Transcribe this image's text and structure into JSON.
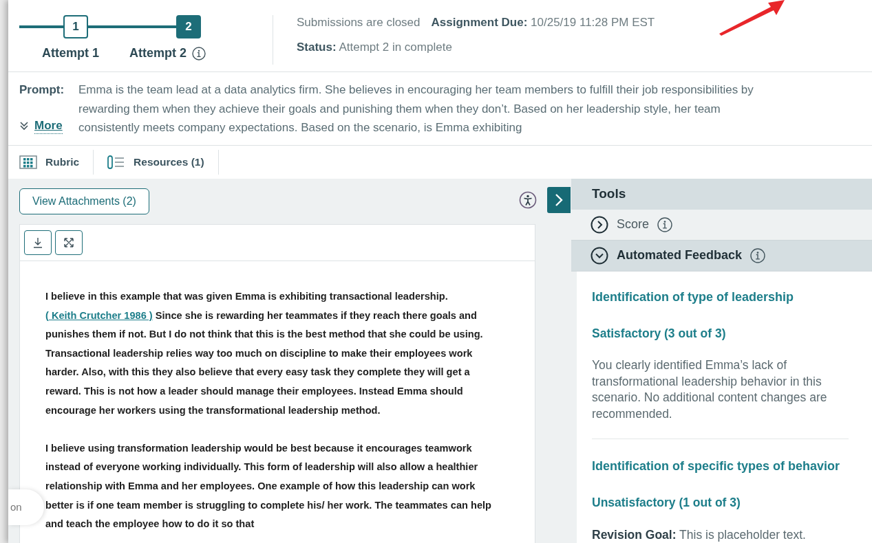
{
  "attempts": [
    {
      "number": "1",
      "label": "Attempt 1",
      "selected": false,
      "info_icon": false
    },
    {
      "number": "2",
      "label": "Attempt 2",
      "selected": true,
      "info_icon": true
    }
  ],
  "submission_note": "Submissions are closed",
  "due": {
    "label": "Assignment Due:",
    "value": "10/25/19 11:28 PM EST"
  },
  "status": {
    "label": "Status:",
    "value": "Attempt 2 in complete"
  },
  "prompt": {
    "label": "Prompt:",
    "more": "More",
    "text": "Emma is the team lead at a data analytics firm. She believes in encouraging her team members to fulfill their job responsibilities by rewarding them when they achieve their goals and punishing them when they don’t. Based on her leadership style, her team consistently meets company expectations. Based on the scenario, is Emma exhibiting"
  },
  "tabs": [
    {
      "kind": "rubric",
      "label": "Rubric"
    },
    {
      "kind": "resources",
      "label": "Resources (1)"
    }
  ],
  "attachments_button": "View Attachments (2)",
  "essay": [
    [
      {
        "kind": "text",
        "text": "I believe in this example that was given Emma is exhibiting transactional leadership."
      },
      {
        "kind": "citation",
        "text": "( Keith Crutcher 1986 )"
      },
      {
        "kind": "text",
        "text": "Since she is rewarding her teammates if they reach there goals and punishes them if not. But I do not think that this is the best method that she could be using. Transactional leadership relies way too much on discipline to make their employees work harder. Also, with this they also believe that every easy task they complete they will get a reward. This is not how a leader should manage their employees. Instead Emma should encourage her workers using the transformational leadership method."
      }
    ],
    [
      {
        "kind": "text",
        "text": "I believe using transformation leadership would be best because it encourages teamwork instead of everyone working individually. This form of leadership will also allow a healthier relationship with Emma and her employees. One example of how this leadership can work better is if one team member is struggling to complete his/ her work. The teammates can help and teach the employee how to do it so that"
      }
    ]
  ],
  "floating_tab": "on",
  "tools": {
    "title": "Tools",
    "sections": [
      {
        "title": "Score",
        "expanded": false
      },
      {
        "title": "Automated Feedback",
        "expanded": true
      }
    ]
  },
  "feedback": [
    {
      "kind": "comment",
      "criterion": "Identification of type of leadership",
      "rating": "Satisfactory (3 out of 3)",
      "comment": "You clearly identified Emma’s lack of transformational leadership behavior in this scenario. No additional content changes are recommended."
    },
    {
      "kind": "goal",
      "criterion": "Identification of specific types of behavior",
      "rating": "Unsatisfactory (1 out of 3)",
      "goal_label": "Revision Goal:",
      "comment": "This is placeholder text."
    }
  ]
}
